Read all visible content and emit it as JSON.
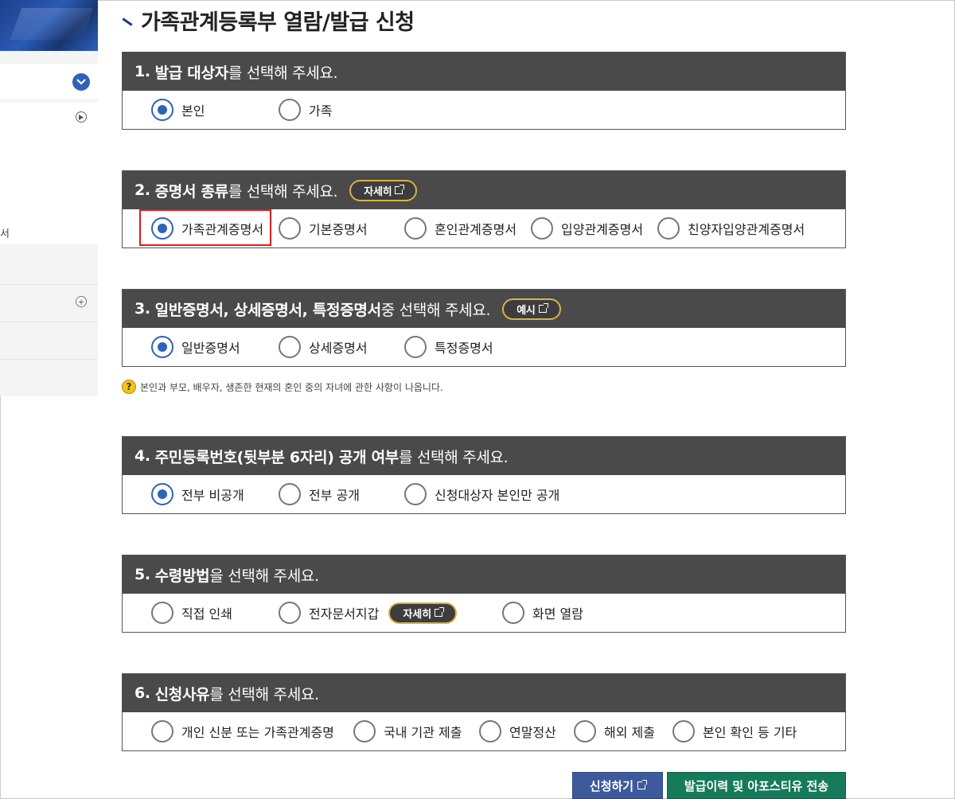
{
  "title": "가족관계등록부 열람/발급 신청",
  "sidebar": {
    "partial_text": "서"
  },
  "sections": [
    {
      "num": "1.",
      "bold": "발급 대상자",
      "rest": "를 선택해 주세요.",
      "options": [
        {
          "label": "본인",
          "selected": true
        },
        {
          "label": "가족",
          "selected": false
        }
      ]
    },
    {
      "num": "2.",
      "bold": "증명서 종류",
      "rest": "를 선택해 주세요.",
      "pill": "자세히",
      "options": [
        {
          "label": "가족관계증명서",
          "selected": true
        },
        {
          "label": "기본증명서",
          "selected": false
        },
        {
          "label": "혼인관계증명서",
          "selected": false
        },
        {
          "label": "입양관계증명서",
          "selected": false
        },
        {
          "label": "친양자입양관계증명서",
          "selected": false
        }
      ]
    },
    {
      "num": "3.",
      "bold": "일반증명서, 상세증명서, 특정증명서",
      "rest": " 중 선택해 주세요.",
      "pill": "예시",
      "options": [
        {
          "label": "일반증명서",
          "selected": true
        },
        {
          "label": "상세증명서",
          "selected": false
        },
        {
          "label": "특정증명서",
          "selected": false
        }
      ]
    },
    {
      "num": "4.",
      "bold": "주민등록번호(뒷부분 6자리) 공개 여부",
      "rest": "를 선택해 주세요.",
      "options": [
        {
          "label": "전부 비공개",
          "selected": true
        },
        {
          "label": "전부 공개",
          "selected": false
        },
        {
          "label": "신청대상자 본인만 공개",
          "selected": false
        }
      ]
    },
    {
      "num": "5.",
      "bold": "수령방법",
      "rest": "을 선택해 주세요.",
      "inline_pill": "자세히",
      "options": [
        {
          "label": "직접 인쇄",
          "selected": false
        },
        {
          "label": "전자문서지갑",
          "selected": false
        },
        {
          "label": "화면 열람",
          "selected": false
        }
      ]
    },
    {
      "num": "6.",
      "bold": "신청사유",
      "rest": "를 선택해 주세요.",
      "options": [
        {
          "label": "개인 신분 또는 가족관계증명",
          "selected": false
        },
        {
          "label": "국내 기관 제출",
          "selected": false
        },
        {
          "label": "연말정산",
          "selected": false
        },
        {
          "label": "해외 제출",
          "selected": false
        },
        {
          "label": "본인 확인 등 기타",
          "selected": false
        }
      ]
    }
  ],
  "note": {
    "icon": "?",
    "text": "본인과 부모, 배우자, 생존한 현재의 혼인 중의 자녀에 관한 사항이 나옵니다."
  },
  "buttons": {
    "apply": "신청하기",
    "history": "발급이력 및 아포스티유 전송"
  },
  "colors": {
    "header_bg": "#4a4a4a",
    "radio_selected": "#2f62b8",
    "pill_border": "#d8b14a",
    "apply_btn": "#3d5a9c",
    "history_btn": "#177a5a",
    "highlight": "#e01c1c"
  }
}
